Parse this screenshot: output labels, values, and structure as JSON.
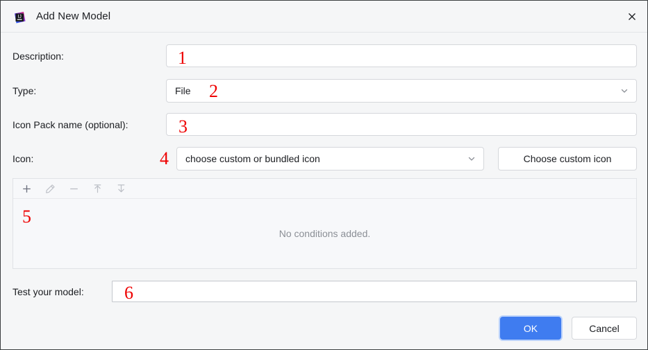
{
  "window": {
    "title": "Add New Model",
    "app_icon": "intellij-idea-icon",
    "close_icon": "close-icon"
  },
  "form": {
    "description": {
      "label": "Description:",
      "value": "",
      "annotation": "1"
    },
    "type": {
      "label": "Type:",
      "value": "File",
      "annotation": "2",
      "chevron_icon": "chevron-down-icon"
    },
    "icon_pack": {
      "label": "Icon Pack name (optional):",
      "value": "",
      "annotation": "3"
    },
    "icon": {
      "label": "Icon:",
      "value": "choose custom or bundled icon",
      "annotation": "4",
      "chevron_icon": "chevron-down-icon",
      "choose_button": "Choose custom icon"
    },
    "test_model": {
      "label": "Test your model:",
      "value": "",
      "annotation": "6"
    }
  },
  "conditions": {
    "annotation": "5",
    "empty_text": "No conditions added.",
    "toolbar": [
      {
        "name": "add-condition-button",
        "icon": "plus-icon",
        "enabled": true
      },
      {
        "name": "edit-condition-button",
        "icon": "pencil-icon",
        "enabled": false
      },
      {
        "name": "remove-condition-button",
        "icon": "minus-icon",
        "enabled": false
      },
      {
        "name": "move-up-button",
        "icon": "arrow-up-icon",
        "enabled": false
      },
      {
        "name": "move-down-button",
        "icon": "arrow-down-icon",
        "enabled": false
      }
    ]
  },
  "footer": {
    "ok_label": "OK",
    "cancel_label": "Cancel"
  },
  "colors": {
    "dialog_background": "#f5f6f7",
    "primary_button": "#3f7cf0",
    "primary_focus_ring": "#bcd3fb",
    "annotation_red": "#ee0000",
    "placeholder_grey": "#8b8f96",
    "text": "#1b1d21"
  }
}
